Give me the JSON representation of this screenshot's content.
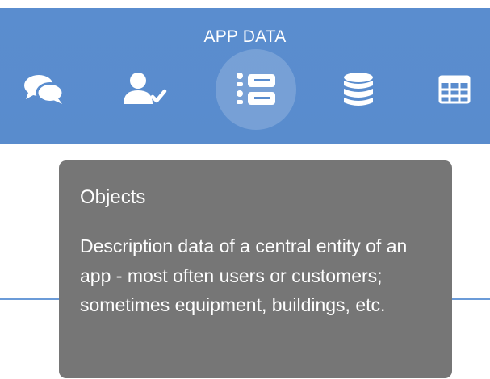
{
  "header": {
    "title": "APP DATA",
    "tabs": [
      {
        "id": "chats",
        "icon": "chat-bubbles-icon",
        "active": false
      },
      {
        "id": "users",
        "icon": "user-check-icon",
        "active": false
      },
      {
        "id": "objects",
        "icon": "objects-list-icon",
        "active": true
      },
      {
        "id": "database",
        "icon": "database-icon",
        "active": false
      },
      {
        "id": "table",
        "icon": "table-grid-icon",
        "active": false
      }
    ],
    "color": "#5a8dcf"
  },
  "tooltip": {
    "title": "Objects",
    "body": "Description data of a central entity of an app - most often users or customers; sometimes equipment, buildings, etc.",
    "background": "#767676"
  }
}
